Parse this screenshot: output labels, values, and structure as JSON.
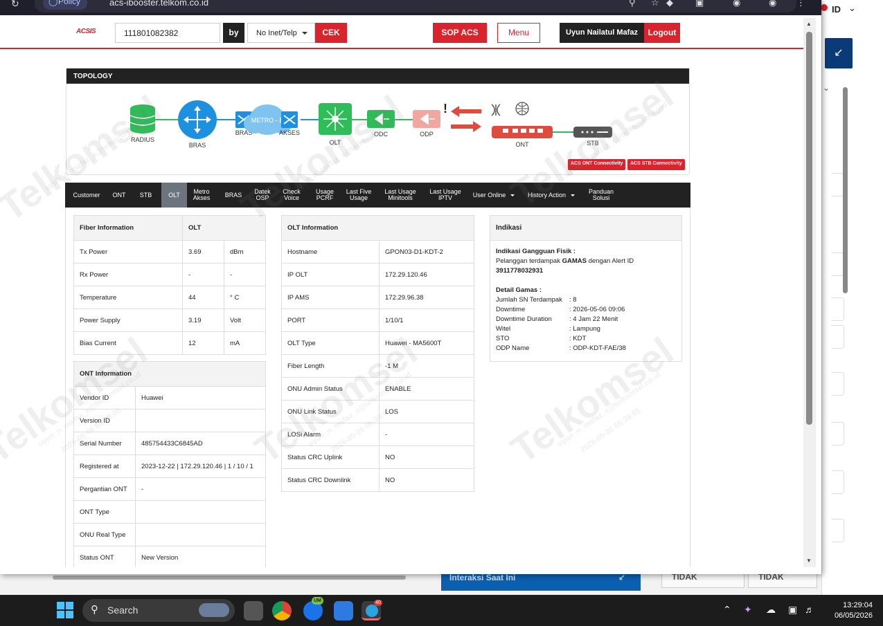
{
  "browser": {
    "policy_label": "Policy",
    "url": "acs-ibooster.telkom.co.id"
  },
  "header": {
    "logo": "ACSIS",
    "search_value": "111801082382",
    "by_label": "by",
    "filter_selected": "No Inet/Telp",
    "cek_label": "CEK",
    "sop_label": "SOP ACS",
    "menu_label": "Menu",
    "user_name": "Uyun Nailatul Mafaz",
    "logout_label": "Logout"
  },
  "topology": {
    "title": "TOPOLOGY",
    "nodes": {
      "radius": "RADIUS",
      "bras": "BRAS",
      "bras2": "BRAS",
      "metro": "METRO - E",
      "akses": "AKSES",
      "olt": "OLT",
      "odc": "ODC",
      "odp": "ODP",
      "ont": "ONT",
      "stb": "STB"
    },
    "alert_mark": "!",
    "btn_ont": "ACS ONT Connectivity",
    "btn_stb": "ACS STB Connectivity"
  },
  "tabs": [
    {
      "label": "Customer"
    },
    {
      "label": "ONT"
    },
    {
      "label": "STB"
    },
    {
      "label": "OLT"
    },
    {
      "label": "Metro Akses"
    },
    {
      "label": "BRAS"
    },
    {
      "label": "Datek OSP"
    },
    {
      "label": "Check Voice"
    },
    {
      "label": "Usage PCRF"
    },
    {
      "label": "Last Five Usage"
    },
    {
      "label": "Last Usage Minitools"
    },
    {
      "label": "Last Usage IPTV"
    },
    {
      "label": "User Online"
    },
    {
      "label": "History Action"
    },
    {
      "label": "Panduan Solusi"
    }
  ],
  "fiber": {
    "h1": "Fiber Information",
    "h2": "OLT",
    "rows": [
      {
        "label": "Tx Power",
        "value": "3.69",
        "unit": "dBm"
      },
      {
        "label": "Rx Power",
        "value": "-",
        "unit": "-"
      },
      {
        "label": "Temperature",
        "value": "44",
        "unit": "° C"
      },
      {
        "label": "Power Supply",
        "value": "3.19",
        "unit": "Volt"
      },
      {
        "label": "Bias Current",
        "value": "12",
        "unit": "mA"
      }
    ]
  },
  "ont": {
    "title": "ONT Information",
    "rows": [
      {
        "label": "Vendor ID",
        "value": "Huawei"
      },
      {
        "label": "Version ID",
        "value": ""
      },
      {
        "label": "Serial Number",
        "value": "485754433C6845AD"
      },
      {
        "label": "Registered at",
        "value": "2023-12-22 | 172.29.120.46 | 1 / 10 / 1"
      },
      {
        "label": "Pergantian ONT",
        "value": "-"
      },
      {
        "label": "ONT Type",
        "value": ""
      },
      {
        "label": "ONU Real Type",
        "value": ""
      },
      {
        "label": "Status ONT",
        "value": "New Version"
      }
    ]
  },
  "olt": {
    "title": "OLT Information",
    "rows": [
      {
        "label": "Hostname",
        "value": "GPON03-D1-KDT-2"
      },
      {
        "label": "IP OLT",
        "value": "172.29.120.46"
      },
      {
        "label": "IP AMS",
        "value": "172.29.96.38"
      },
      {
        "label": "PORT",
        "value": "1/10/1"
      },
      {
        "label": "OLT Type",
        "value": "Huawei - MA5600T"
      },
      {
        "label": "Fiber Length",
        "value": "-1 M"
      },
      {
        "label": "ONU Admin Status",
        "value": "ENABLE"
      },
      {
        "label": "ONU Link Status",
        "value": "LOS"
      },
      {
        "label": "LOSi Alarm",
        "value": "-"
      },
      {
        "label": "Status CRC Uplink",
        "value": "NO"
      },
      {
        "label": "Status CRC Downlink",
        "value": "NO"
      }
    ]
  },
  "indikasi": {
    "title": "Indikasi",
    "gangguan_title": "Indikasi Gangguan Fisik :",
    "gangguan_line_pre": "Pelanggan terdampak ",
    "gangguan_bold": "GAMAS",
    "gangguan_line_post": " dengan Alert ID",
    "alert_id": "3911778032931",
    "detail_title": "Detail Gamas :",
    "details": [
      {
        "k": "Jumlah SN Terdampak",
        "v": ": 8"
      },
      {
        "k": "Downtime",
        "v": ": 2026-05-06 09:06"
      },
      {
        "k": "Downtime Duration",
        "v": ": 4 Jam 22 Menit"
      },
      {
        "k": "Witel",
        "v": ": Lampung"
      },
      {
        "k": "STO",
        "v": ": KDT"
      },
      {
        "k": "ODP Name",
        "v": ": ODP-KDT-FAE/38"
      }
    ]
  },
  "watermark": {
    "brand": "Telkomsel",
    "email": "uyun_n_mafaz_x@telkomsel.co.id",
    "stamp": "2026-05-06 05:38:05"
  },
  "background": {
    "lang": "ID",
    "banner": "Interaksi Saat Ini",
    "tidak1": "TIDAK",
    "tidak2": "TIDAK"
  },
  "taskbar": {
    "search_label": "Search",
    "time": "13:29:04",
    "date": "06/05/2026",
    "badge_um": "UM",
    "badge_count": "40"
  },
  "colors": {
    "brand_red": "#d9232d",
    "dark": "#222222",
    "topo_green": "#2ebd59",
    "topo_blue": "#1e90e0"
  }
}
